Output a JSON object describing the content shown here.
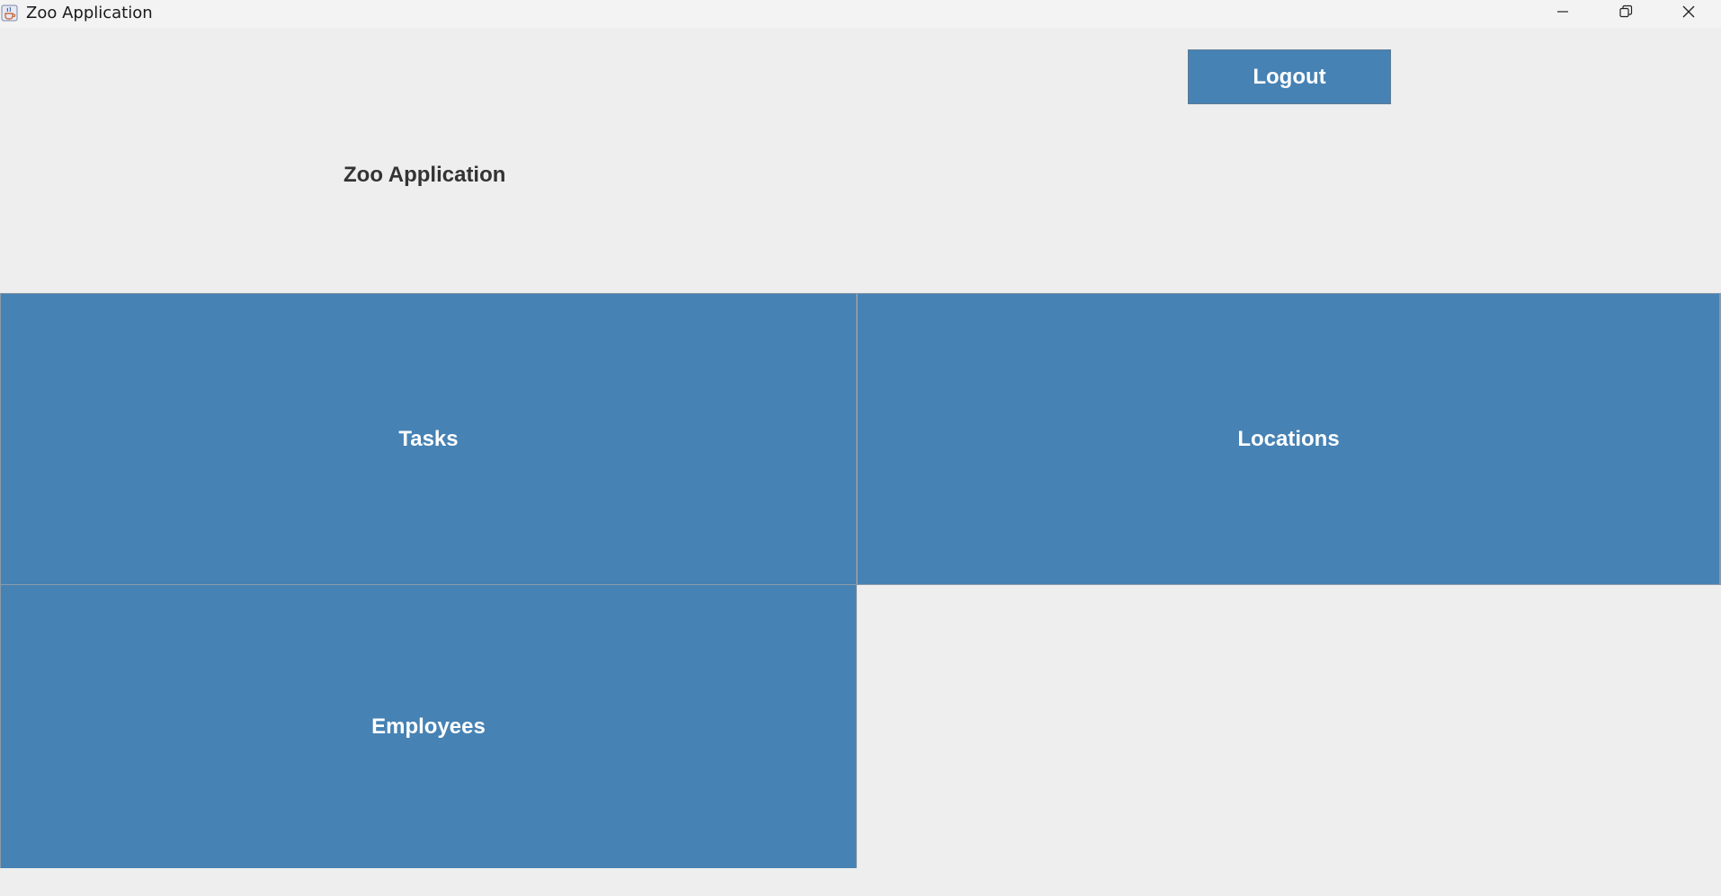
{
  "window": {
    "title": "Zoo Application",
    "icon": "java-cup-icon",
    "controls": [
      "minimize-icon",
      "restore-icon",
      "close-icon"
    ]
  },
  "header": {
    "logout_label": "Logout",
    "heading": "Zoo Application"
  },
  "tiles": [
    {
      "label": "Tasks"
    },
    {
      "label": "Locations"
    },
    {
      "label": "Employees"
    }
  ],
  "colors": {
    "accent": "#4682b4",
    "background": "#eeeeee",
    "titlebar": "#f3f3f3",
    "heading_text": "#333333",
    "tile_text": "#ffffff"
  }
}
